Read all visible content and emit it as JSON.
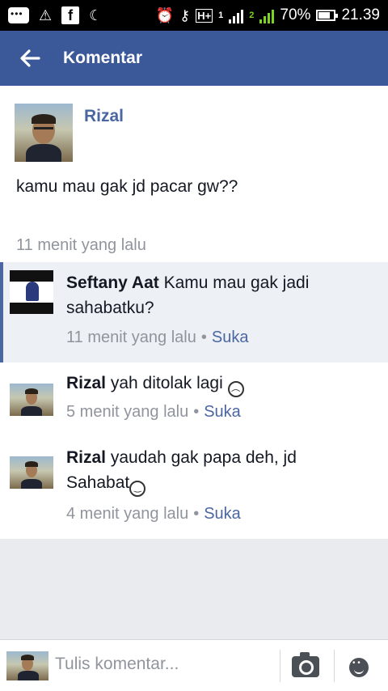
{
  "status_bar": {
    "battery": "70%",
    "time": "21.39",
    "network": "H+",
    "sim2_badge": "2",
    "sim1_badge": "1"
  },
  "app_bar": {
    "title": "Komentar"
  },
  "post": {
    "author": "Rizal",
    "text": "kamu mau gak jd pacar gw??",
    "time": "11 menit yang lalu"
  },
  "comments": [
    {
      "author": "Seftany Aat",
      "text": "Kamu mau gak jadi sahabatku?",
      "time": "11 menit yang lalu",
      "separator": "•",
      "like": "Suka",
      "highlighted": true
    },
    {
      "author": "Rizal",
      "text": "yah ditolak lagi",
      "emoji": "sad",
      "time": "5 menit yang lalu",
      "separator": "•",
      "like": "Suka"
    },
    {
      "author": "Rizal",
      "text": "yaudah gak papa deh, jd Sahabat",
      "emoji": "grin",
      "time": "4 menit yang lalu",
      "separator": "•",
      "like": "Suka"
    }
  ],
  "composer": {
    "placeholder": "Tulis komentar..."
  },
  "colors": {
    "brand": "#3b5998",
    "link": "#4b67a1",
    "meta": "#90949c"
  }
}
